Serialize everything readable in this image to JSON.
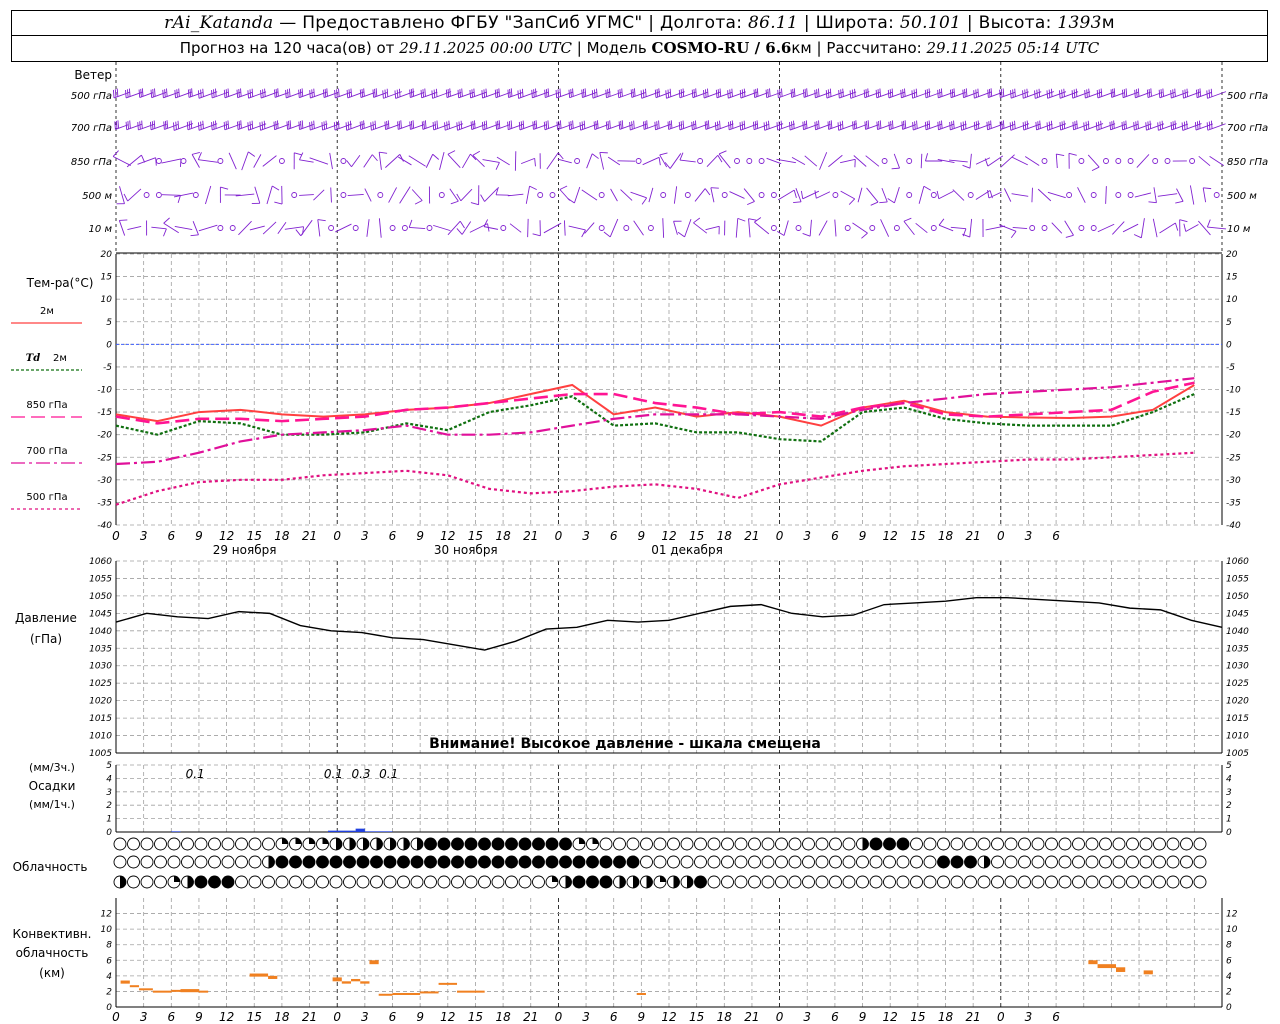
{
  "header": {
    "station": "rAi_Katanda",
    "dash": " — ",
    "provider": "Предоставлено ФГБУ \"ЗапСиб УГМС\"",
    "lon_label": "Долгота:",
    "lon_value": "86.11",
    "lat_label": "Широта:",
    "lat_value": "50.101",
    "alt_label": "Высота:",
    "alt_value": "1393",
    "alt_unit": "м",
    "sep": " | ",
    "forecast_label": "Прогноз на 120 часа(ов) от",
    "forecast_start": "29.11.2025 00:00 UTC",
    "model_label": "Модель",
    "model_name": "COSMO-RU / 6.6",
    "model_unit": "км",
    "calc_label": "Рассчитано:",
    "calc_time": "29.11.2025 05:14 UTC"
  },
  "labels": {
    "wind": "Ветер",
    "level_500hpa": "500 гПа",
    "level_700hpa": "700 гПа",
    "level_850hpa": "850 гПа",
    "level_500m": "500 м",
    "level_10m": "10  м",
    "temp_title": "Тем-ра(°C)",
    "temp_2m": "2м",
    "td": "Td",
    "td_2m": "2м",
    "t850": "850 гПа",
    "t700": "700 гПа",
    "t500": "500 гПа",
    "pressure_title": "Давление",
    "pressure_unit": "(гПа)",
    "pressure_warning": "Внимание! Высокое давление - шкала смещена",
    "precip_unit3": "(мм/3ч.)",
    "precip_title": "Осадки",
    "precip_unit1": "(мм/1ч.)",
    "cloud_title": "Облачность",
    "conv_title1": "Конвективн.",
    "conv_title2": "облачность",
    "conv_title3": "(км)"
  },
  "colors": {
    "t2m": "#ff4040",
    "td2m": "#107010",
    "t850": "#ff1493",
    "t700": "#e0109a",
    "t500": "#e01080",
    "wind": "#8020d0",
    "pressure": "#000000",
    "precip": "#2040e0",
    "conv": "#f08020",
    "zero": "#4060ff"
  },
  "chart_data": [
    {
      "type": "line",
      "name": "temperature",
      "x_hours": [
        0,
        3,
        6,
        9,
        12,
        15,
        18,
        21,
        24,
        27,
        30,
        33,
        36,
        39,
        42,
        45,
        48,
        51,
        54,
        57,
        60,
        63,
        66,
        69,
        72,
        75,
        78,
        81,
        84,
        87,
        90,
        93,
        96,
        99,
        102,
        105,
        108,
        111,
        114,
        117,
        120
      ],
      "x_tick_labels": [
        "0",
        "3",
        "6",
        "9",
        "12",
        "15",
        "18",
        "21",
        "0",
        "3",
        "6",
        "9",
        "12",
        "15",
        "18",
        "21",
        "0",
        "3",
        "6",
        "9",
        "12",
        "15",
        "18",
        "21",
        "0",
        "3",
        "6",
        "9",
        "12",
        "15",
        "18",
        "21",
        "0",
        "3",
        "6"
      ],
      "day_labels": [
        "29 ноября",
        "30 ноября",
        "01 декабря"
      ],
      "ylim": [
        -40,
        20
      ],
      "yticks": [
        20,
        15,
        10,
        5,
        0,
        -5,
        -10,
        -15,
        -20,
        -25,
        -30,
        -35,
        -40
      ],
      "series": [
        {
          "name": "2м",
          "values": [
            -15.5,
            -17,
            -15,
            -14.5,
            -15.5,
            -16,
            -15.5,
            -14.5,
            -14,
            -13,
            -11,
            -9,
            -15.5,
            -14,
            -16,
            -15,
            -16,
            -18,
            -14,
            -12.5,
            -15,
            -16,
            -16.2,
            -16.3,
            -16,
            -14.5,
            -9
          ]
        },
        {
          "name": "Td 2м",
          "values": [
            -18,
            -20,
            -17,
            -17.5,
            -20,
            -20,
            -19.5,
            -17.5,
            -19,
            -15,
            -13.5,
            -11.5,
            -18,
            -17.5,
            -19.5,
            -19.5,
            -21,
            -21.5,
            -15,
            -14,
            -16.5,
            -17.5,
            -18,
            -18,
            -18,
            -15,
            -11
          ]
        },
        {
          "name": "850 гПа",
          "values": [
            -16,
            -17.5,
            -16.5,
            -16.5,
            -17,
            -16.5,
            -16,
            -14.5,
            -14,
            -13,
            -12,
            -11,
            -11,
            -13,
            -14,
            -15.5,
            -15,
            -16,
            -14,
            -13,
            -15.5,
            -16,
            -15.5,
            -15,
            -14.5,
            -10.5,
            -8.5
          ]
        },
        {
          "name": "700 гПа",
          "values": [
            -26.5,
            -26,
            -24,
            -21.5,
            -20,
            -19.5,
            -19,
            -18,
            -20,
            -20,
            -19.5,
            -18,
            -16.5,
            -15.5,
            -15.5,
            -15.5,
            -16,
            -16.5,
            -14.5,
            -13,
            -12,
            -11,
            -10.5,
            -10,
            -9.5,
            -8.5,
            -7.5
          ]
        },
        {
          "name": "500 гПа",
          "values": [
            -35.5,
            -32.5,
            -30.5,
            -30,
            -30,
            -29,
            -28.5,
            -28,
            -29,
            -32,
            -33,
            -32.5,
            -31.5,
            -31,
            -32,
            -34,
            -31,
            -29.5,
            -28,
            -27,
            -26.5,
            -26,
            -25.5,
            -25.5,
            -25,
            -24.5,
            -24
          ]
        }
      ],
      "series_hours": [
        0,
        4.5,
        9,
        13.5,
        18,
        22.5,
        27,
        31.5,
        36,
        40.5,
        45,
        49.5,
        54,
        58.5,
        63,
        67.5,
        72,
        76.5,
        81,
        85.5,
        90,
        94.5,
        99,
        103.5,
        108,
        112.5,
        117
      ]
    },
    {
      "type": "line",
      "name": "pressure",
      "ylim": [
        1005,
        1060
      ],
      "yticks": [
        1060,
        1055,
        1050,
        1045,
        1040,
        1035,
        1030,
        1025,
        1020,
        1015,
        1010,
        1005
      ],
      "x_hours": [
        0,
        3,
        6,
        9,
        12,
        15,
        18,
        21,
        24,
        27,
        30,
        33,
        36,
        39,
        42,
        45,
        48,
        51,
        54,
        57,
        60,
        63,
        66,
        69,
        72,
        75,
        78,
        81,
        84,
        87,
        90,
        93,
        96,
        99,
        102,
        105,
        108,
        111,
        114,
        117,
        120
      ],
      "values": [
        1042.5,
        1045,
        1044,
        1043.5,
        1045.5,
        1045,
        1041.5,
        1040,
        1039.5,
        1038,
        1037.5,
        1036,
        1034.5,
        1037,
        1040.5,
        1041,
        1043,
        1042.5,
        1043,
        1045,
        1047,
        1047.5,
        1045,
        1044,
        1044.5,
        1047.5,
        1048,
        1048.5,
        1049.5,
        1049.5,
        1049,
        1048.5,
        1048,
        1046.5,
        1046,
        1043,
        1041
      ]
    },
    {
      "type": "bar",
      "name": "precipitation",
      "ylim": [
        0,
        5
      ],
      "yticks": [
        5,
        4,
        3,
        2,
        1,
        0
      ],
      "bars": [
        {
          "hour_start": 6,
          "hour_end": 7,
          "value": 0.05
        },
        {
          "hour_start": 23,
          "hour_end": 26,
          "value": 0.1
        },
        {
          "hour_start": 26,
          "hour_end": 27,
          "value": 0.25
        },
        {
          "hour_start": 27,
          "hour_end": 30,
          "value": 0.05
        }
      ],
      "annotations": [
        {
          "hour": 7.5,
          "text": "0.1"
        },
        {
          "hour": 22.5,
          "text": "0.1"
        },
        {
          "hour": 25.5,
          "text": "0.3"
        },
        {
          "hour": 28.5,
          "text": "0.1"
        }
      ]
    },
    {
      "type": "table",
      "name": "cloudiness",
      "rows": [
        "000000000000222344455556666667666622000000000000000000046660000000000000000000000000000000000000000000000000000000000000034455555",
        "000000000004666666666666666666666666666000000000000000000000066640000000000000000000000000000000000000000000000000000000000000000444444",
        "400034666000000000000000000000003466644434460000000000000000000000000000000000000000000000000000000000000000000000000000000000"
      ]
    },
    {
      "type": "bar",
      "name": "convective_cloud",
      "ylim": [
        0,
        14
      ],
      "yticks": [
        12,
        10,
        8,
        6,
        4,
        2,
        0
      ],
      "segments": [
        {
          "hour_start": 0.5,
          "hour_end": 1.5,
          "base": 3,
          "top": 3.4
        },
        {
          "hour_start": 1.5,
          "hour_end": 2.5,
          "base": 2.6,
          "top": 2.8
        },
        {
          "hour_start": 2.5,
          "hour_end": 4,
          "base": 2.2,
          "top": 2.4
        },
        {
          "hour_start": 4,
          "hour_end": 6,
          "base": 2,
          "top": 2.1
        },
        {
          "hour_start": 6,
          "hour_end": 7,
          "base": 2,
          "top": 2.2
        },
        {
          "hour_start": 7,
          "hour_end": 9,
          "base": 1.9,
          "top": 2.3
        },
        {
          "hour_start": 9,
          "hour_end": 10,
          "base": 2,
          "top": 2.1
        },
        {
          "hour_start": 14.5,
          "hour_end": 16.5,
          "base": 3.9,
          "top": 4.3
        },
        {
          "hour_start": 16.5,
          "hour_end": 17.5,
          "base": 3.6,
          "top": 4
        },
        {
          "hour_start": 23.5,
          "hour_end": 24.5,
          "base": 3.3,
          "top": 3.8
        },
        {
          "hour_start": 24.5,
          "hour_end": 25.5,
          "base": 3,
          "top": 3.3
        },
        {
          "hour_start": 25.5,
          "hour_end": 26.5,
          "base": 3.3,
          "top": 3.6
        },
        {
          "hour_start": 26.5,
          "hour_end": 27.5,
          "base": 3,
          "top": 3.3
        },
        {
          "hour_start": 27.5,
          "hour_end": 28.5,
          "base": 5.5,
          "top": 6
        },
        {
          "hour_start": 28.5,
          "hour_end": 30,
          "base": 1.6,
          "top": 1.7
        },
        {
          "hour_start": 30,
          "hour_end": 33,
          "base": 1.7,
          "top": 1.8
        },
        {
          "hour_start": 33,
          "hour_end": 35,
          "base": 1.9,
          "top": 2
        },
        {
          "hour_start": 35,
          "hour_end": 37,
          "base": 2.9,
          "top": 3.1
        },
        {
          "hour_start": 37,
          "hour_end": 40,
          "base": 2,
          "top": 2.1
        },
        {
          "hour_start": 56.5,
          "hour_end": 57.5,
          "base": 1.6,
          "top": 1.8
        },
        {
          "hour_start": 105.5,
          "hour_end": 106.5,
          "base": 5.5,
          "top": 6
        },
        {
          "hour_start": 106.5,
          "hour_end": 108.5,
          "base": 5,
          "top": 5.5
        },
        {
          "hour_start": 108.5,
          "hour_end": 109.5,
          "base": 4.5,
          "top": 5.1
        },
        {
          "hour_start": 111.5,
          "hour_end": 112.5,
          "base": 4.2,
          "top": 4.7
        }
      ]
    }
  ]
}
